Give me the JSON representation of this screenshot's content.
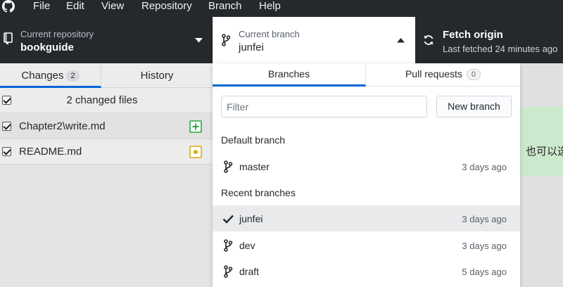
{
  "menu": {
    "items": [
      "File",
      "Edit",
      "View",
      "Repository",
      "Branch",
      "Help"
    ]
  },
  "toolbar": {
    "repo_label": "Current repository",
    "repo_value": "bookguide",
    "branch_label": "Current branch",
    "branch_value": "junfei",
    "fetch_title": "Fetch origin",
    "fetch_subtitle": "Last fetched 24 minutes ago"
  },
  "left": {
    "tabs": {
      "changes_label": "Changes",
      "changes_count": "2",
      "history_label": "History"
    },
    "summary": "2 changed files",
    "files": [
      {
        "name": "Chapter2\\write.md",
        "status": "added"
      },
      {
        "name": "README.md",
        "status": "modified"
      }
    ]
  },
  "dropdown": {
    "tabs": {
      "branches_label": "Branches",
      "prs_label": "Pull requests",
      "prs_count": "0"
    },
    "filter_placeholder": "Filter",
    "new_branch_label": "New branch",
    "default_header": "Default branch",
    "default_branch": {
      "name": "master",
      "time": "3 days ago"
    },
    "recent_header": "Recent branches",
    "recent_branches": [
      {
        "name": "junfei",
        "time": "3 days ago",
        "current": true
      },
      {
        "name": "dev",
        "time": "3 days ago",
        "current": false
      },
      {
        "name": "draft",
        "time": "5 days ago",
        "current": false
      }
    ]
  },
  "right_partial_text": "，也可以选",
  "colors": {
    "toolbar_bg": "#24292e",
    "accent_blue": "#0366d6",
    "added_green": "#28a745",
    "modified_yellow": "#dbab09"
  }
}
